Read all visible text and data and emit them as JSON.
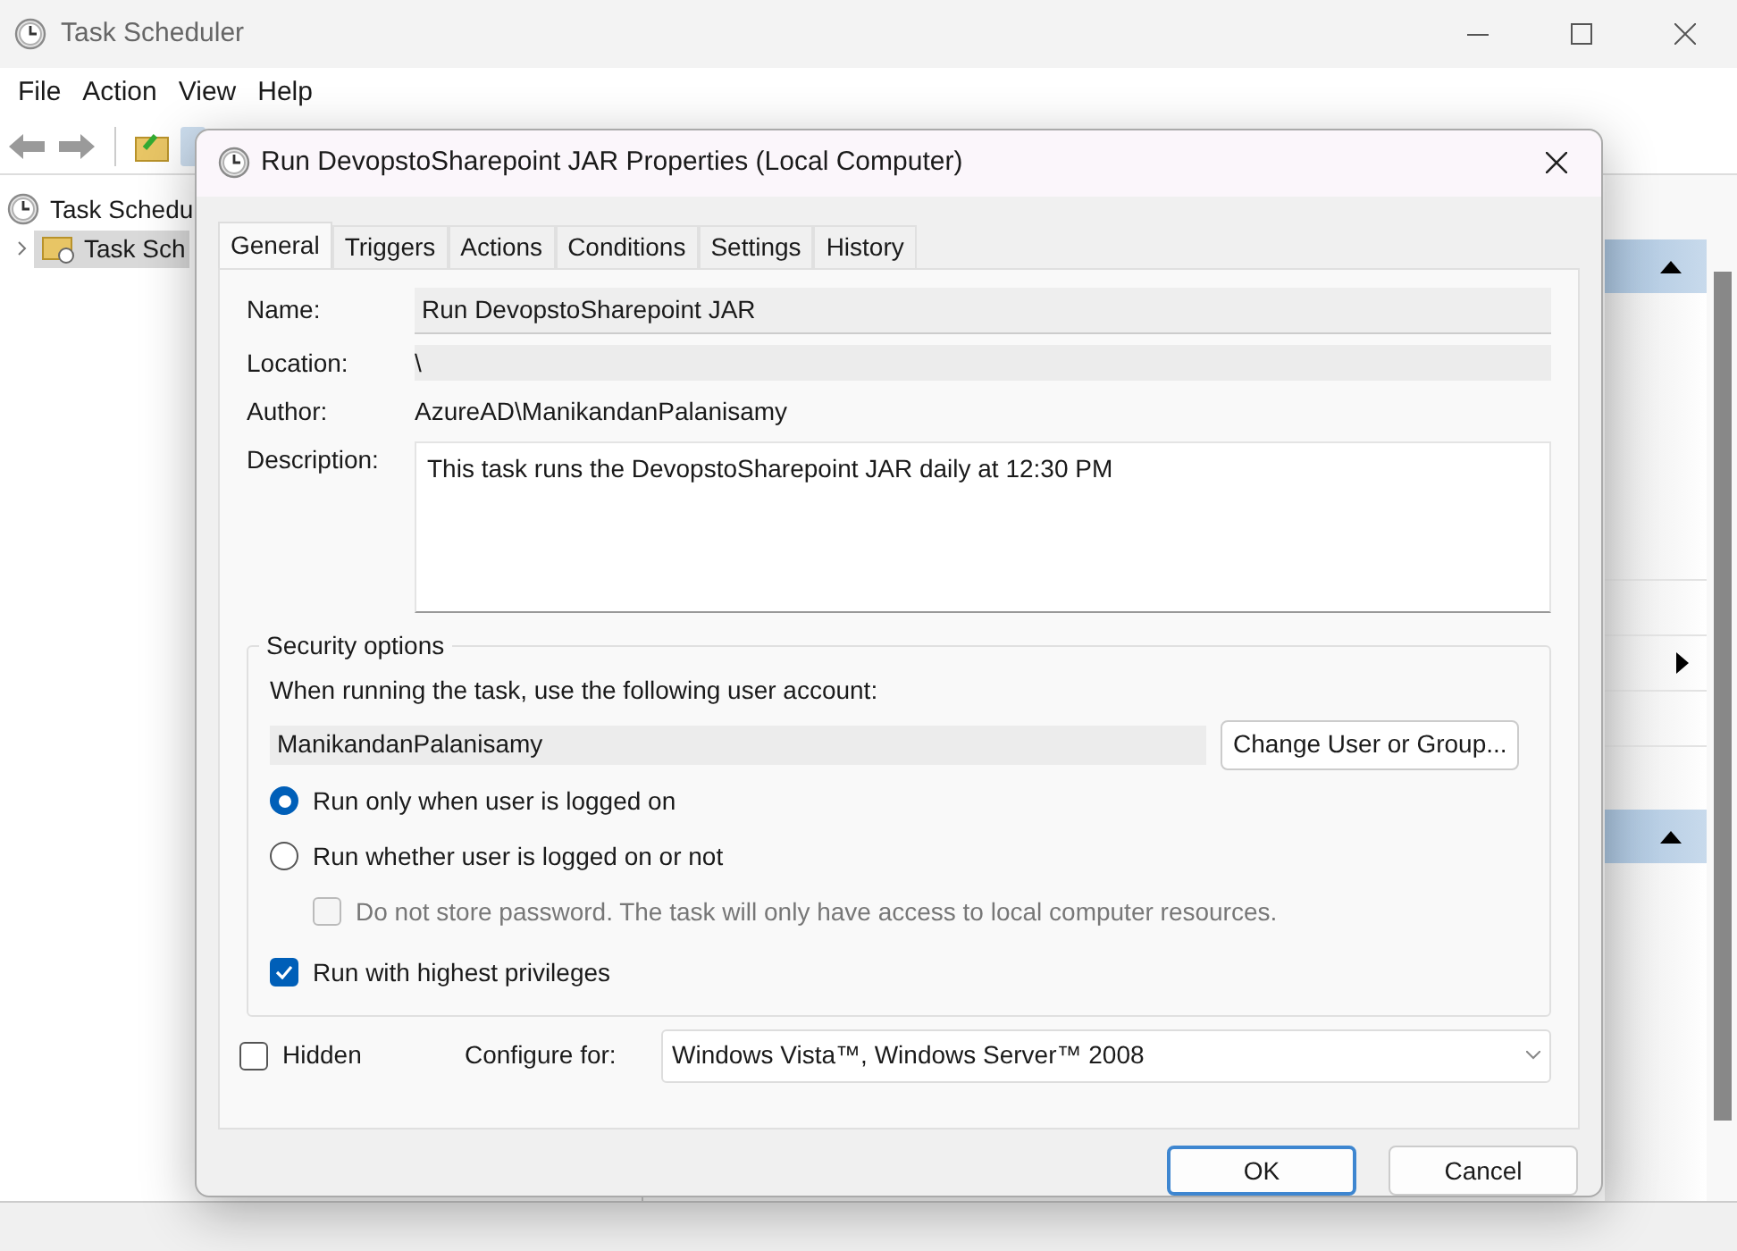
{
  "window": {
    "title": "Task Scheduler"
  },
  "menu": [
    "File",
    "Action",
    "View",
    "Help"
  ],
  "tree": [
    {
      "label": "Task Schedu",
      "selected": false,
      "children": [
        {
          "label": "Task Sch",
          "selected": true
        }
      ]
    }
  ],
  "dialog": {
    "title": "Run DevopstoSharepoint JAR Properties (Local Computer)",
    "tabs": [
      {
        "label": "General",
        "selected": true
      },
      {
        "label": "Triggers",
        "selected": false
      },
      {
        "label": "Actions",
        "selected": false
      },
      {
        "label": "Conditions",
        "selected": false
      },
      {
        "label": "Settings",
        "selected": false
      },
      {
        "label": "History",
        "selected": false
      }
    ],
    "fields": [
      {
        "label": "Name:",
        "value": "Run DevopstoSharepoint JAR",
        "kind": "input"
      },
      {
        "label": "Location:",
        "value": "\\",
        "kind": "readonly"
      },
      {
        "label": "Author:",
        "value": "AzureAD\\ManikandanPalanisamy",
        "kind": "text"
      },
      {
        "label": "Description:",
        "value": "This task runs the DevopstoSharepoint JAR daily at 12:30 PM",
        "kind": "textarea"
      }
    ],
    "security": {
      "title": "Security options",
      "account_label": "When running the task, use the following user account:",
      "account": "ManikandanPalanisamy",
      "change_button": "Change User or Group...",
      "options": [
        {
          "kind": "radio",
          "label": "Run only when user is logged on",
          "selected": true,
          "disabled": false
        },
        {
          "kind": "radio",
          "label": "Run whether user is logged on or not",
          "selected": false,
          "disabled": false
        },
        {
          "kind": "subcheck",
          "label": "Do not store password.  The task will only have access to local computer resources.",
          "checked": false,
          "disabled": true
        },
        {
          "kind": "check",
          "label": "Run with highest privileges",
          "checked": true,
          "disabled": false
        }
      ]
    },
    "hidden": {
      "label": "Hidden",
      "checked": false
    },
    "configure": {
      "label": "Configure for:",
      "value": "Windows Vista™, Windows Server™ 2008"
    },
    "buttons": [
      {
        "label": "OK",
        "kind": "default"
      },
      {
        "label": "Cancel",
        "kind": "normal"
      }
    ]
  }
}
